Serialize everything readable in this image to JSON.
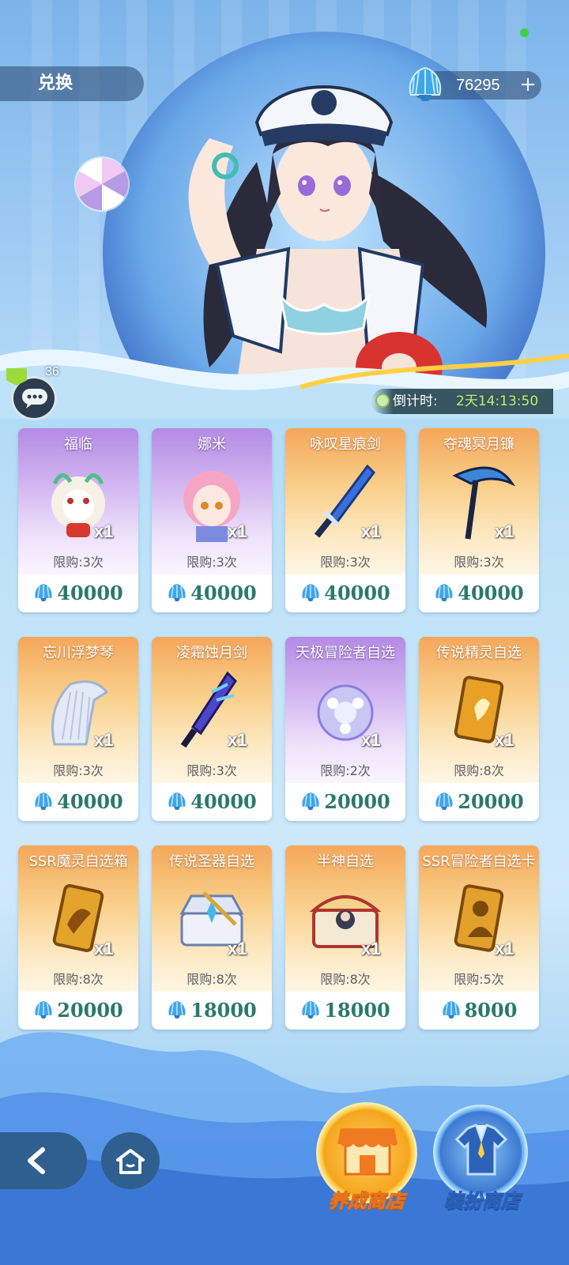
{
  "header": {
    "title": "兑换",
    "currency_value": "76295",
    "currency_plus": "+"
  },
  "chat": {
    "unread_count": "36"
  },
  "countdown": {
    "label": "倒计时:",
    "value": "2天14:13:50"
  },
  "items": [
    {
      "name": "福临",
      "qty": "x1",
      "limit": "限购:3次",
      "price": "40000",
      "theme": "purple",
      "icon": "lion-character-icon"
    },
    {
      "name": "娜米",
      "qty": "x1",
      "limit": "限购:3次",
      "price": "40000",
      "theme": "purple",
      "icon": "pink-girl-character-icon"
    },
    {
      "name": "咏叹星痕剑",
      "qty": "x1",
      "limit": "限购:3次",
      "price": "40000",
      "theme": "orange",
      "icon": "sword-icon"
    },
    {
      "name": "夺魂冥月镰",
      "qty": "x1",
      "limit": "限购:3次",
      "price": "40000",
      "theme": "orange",
      "icon": "scythe-icon"
    },
    {
      "name": "忘川浮梦琴",
      "qty": "x1",
      "limit": "限购:3次",
      "price": "40000",
      "theme": "orange",
      "icon": "harp-icon"
    },
    {
      "name": "凌霜蚀月剑",
      "qty": "x1",
      "limit": "限购:3次",
      "price": "40000",
      "theme": "orange",
      "icon": "frost-sword-icon"
    },
    {
      "name": "天极冒险者自选",
      "qty": "x1",
      "limit": "限购:2次",
      "price": "20000",
      "theme": "purple",
      "icon": "crystal-orb-icon"
    },
    {
      "name": "传说精灵自选",
      "qty": "x1",
      "limit": "限购:8次",
      "price": "20000",
      "theme": "orange",
      "icon": "spirit-card-icon"
    },
    {
      "name": "SSR魔灵自选箱",
      "qty": "x1",
      "limit": "限购:8次",
      "price": "20000",
      "theme": "orange",
      "icon": "dragon-card-icon"
    },
    {
      "name": "传说圣器自选",
      "qty": "x1",
      "limit": "限购:8次",
      "price": "18000",
      "theme": "orange",
      "icon": "relic-chest-icon"
    },
    {
      "name": "半神自选",
      "qty": "x1",
      "limit": "限购:8次",
      "price": "18000",
      "theme": "orange",
      "icon": "treasure-chest-icon"
    },
    {
      "name": "SSR冒险者自选卡",
      "qty": "x1",
      "limit": "限购:5次",
      "price": "8000",
      "theme": "orange",
      "icon": "hero-card-icon"
    }
  ],
  "bottom": {
    "shop_cultivate_label": "养成商店",
    "shop_dress_label": "装扮商店"
  },
  "colors": {
    "price_text": "#2a7a6b",
    "countdown_value": "#b8f06a",
    "shell_blue": "#3fa6e8"
  }
}
